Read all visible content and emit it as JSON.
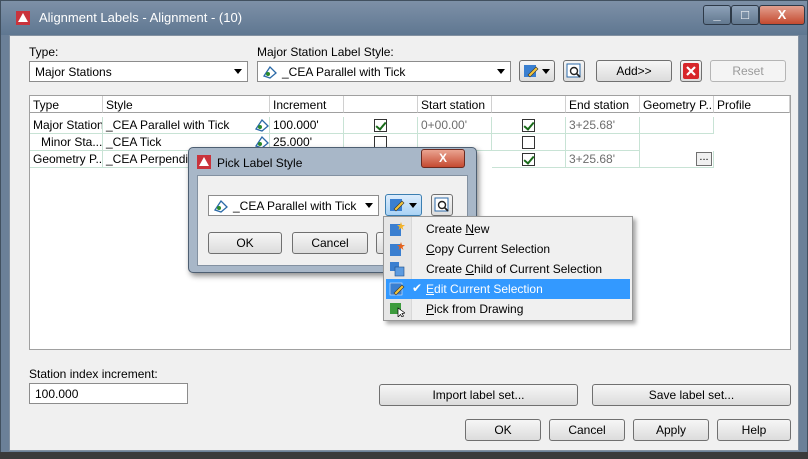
{
  "window": {
    "title": "Alignment Labels - Alignment - (10)",
    "caption_buttons": [
      "_",
      "□",
      "X"
    ]
  },
  "type_field": {
    "label": "Type:",
    "value": "Major Stations"
  },
  "major_style_field": {
    "label": "Major Station Label Style:",
    "value": "_CEA Parallel with Tick"
  },
  "buttons": {
    "add": "Add>>",
    "reset": "Reset",
    "import": "Import label set...",
    "save": "Save label set...",
    "ok": "OK",
    "cancel": "Cancel",
    "apply": "Apply",
    "help": "Help"
  },
  "grid": {
    "headers": [
      "Type",
      "Style",
      "Increment",
      "",
      "Start station",
      "",
      "End station",
      "Geometry P...",
      "Profile"
    ],
    "rows": [
      {
        "type": "Major Stations",
        "style": "_CEA Parallel with Tick",
        "increment": "100.000'",
        "start_checked": true,
        "start": "0+00.00'",
        "end_checked": true,
        "end": "3+25.68'"
      },
      {
        "type": "Minor Sta...",
        "style": "_CEA Tick",
        "increment": "25.000'",
        "start_checked": false,
        "start": "",
        "end_checked": false,
        "end": ""
      },
      {
        "type": "Geometry P...",
        "style": "_CEA Perpendicular",
        "increment": "",
        "start_checked": false,
        "start": "",
        "end_checked": true,
        "end": "3+25.68'"
      }
    ]
  },
  "station_index": {
    "label": "Station index increment:",
    "value": "100.000"
  },
  "pick_dialog": {
    "title": "Pick Label Style",
    "style_value": "_CEA Parallel with Tick",
    "ok": "OK",
    "cancel": "Cancel"
  },
  "context_menu": {
    "items": [
      {
        "pre": "Create ",
        "mnemonic": "N",
        "post": "ew",
        "icon": "create-new-icon"
      },
      {
        "pre": "",
        "mnemonic": "C",
        "post": "opy Current Selection",
        "icon": "copy-icon"
      },
      {
        "pre": "Create ",
        "mnemonic": "C",
        "post": "hild of Current Selection",
        "icon": "create-child-icon"
      },
      {
        "pre": "",
        "mnemonic": "E",
        "post": "dit Current Selection",
        "icon": "edit-icon",
        "checked": true
      },
      {
        "pre": "",
        "mnemonic": "P",
        "post": "ick from Drawing",
        "icon": "pick-icon"
      }
    ]
  },
  "colors": {
    "highlight": "#3399ff",
    "close_red": "#c44a2f",
    "titlebar": "#6b8098"
  }
}
